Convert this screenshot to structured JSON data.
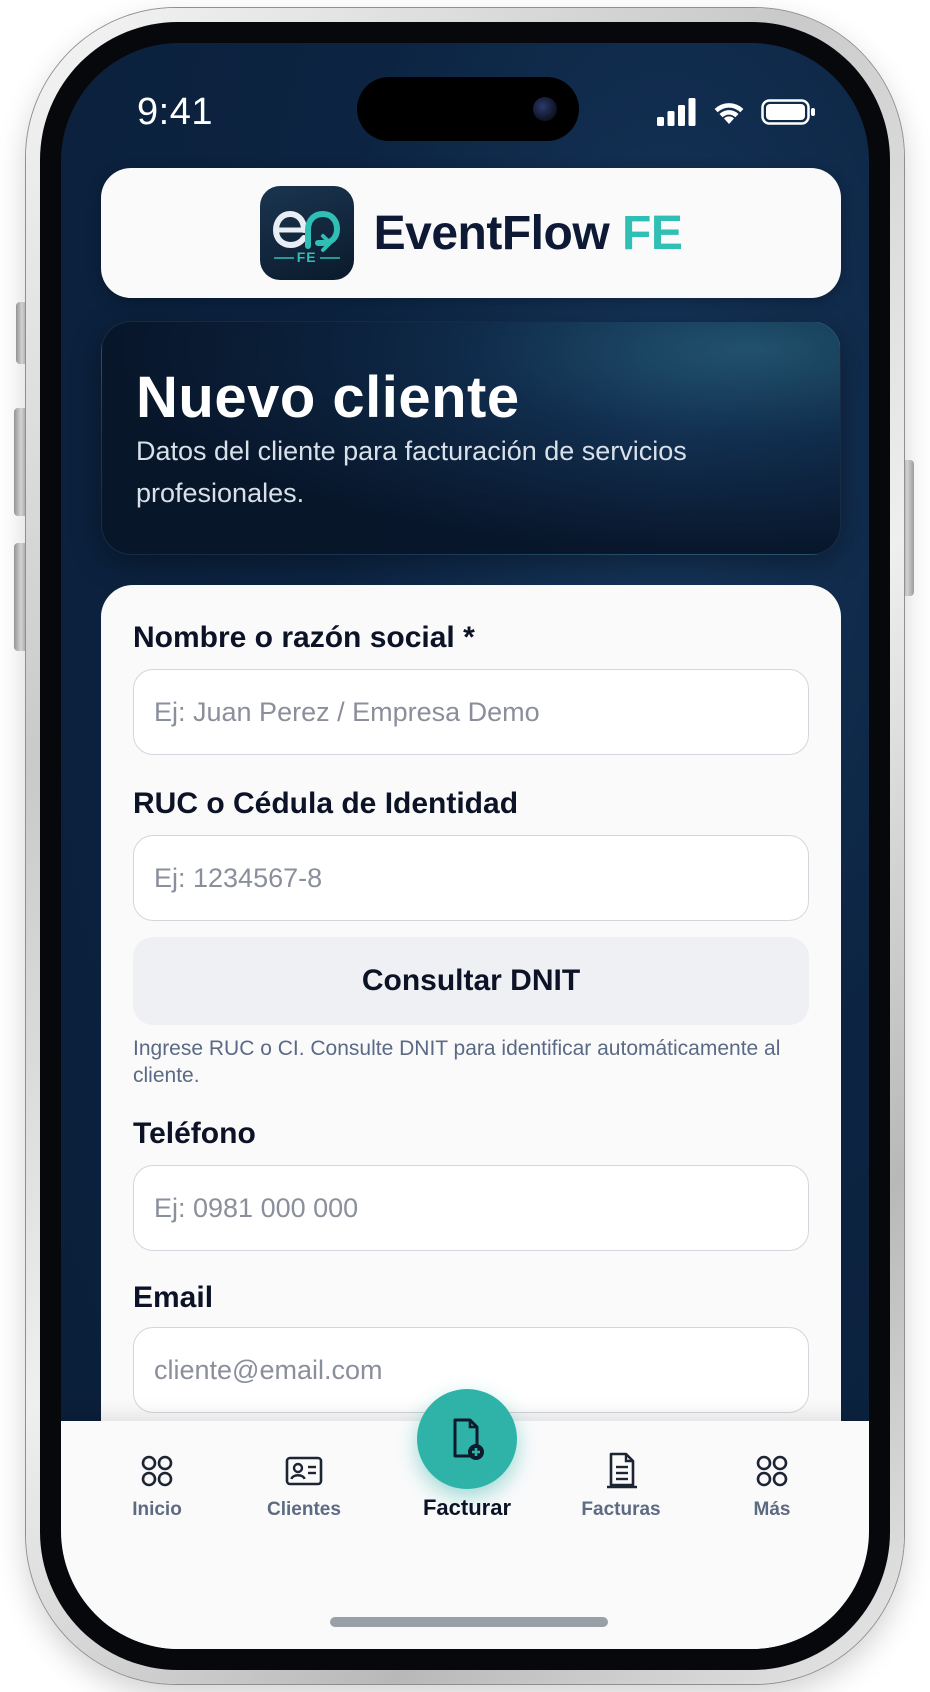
{
  "status_bar": {
    "time": "9:41"
  },
  "brand": {
    "logo_icon": "eventflow-logo-icon",
    "logo_badge": "FE",
    "name": "EventFlow",
    "suffix": "FE",
    "accent_color": "#2fbfb4",
    "dark_color": "#0e1a35"
  },
  "hero": {
    "title": "Nuevo cliente",
    "subtitle": "Datos del cliente para facturación de servicios profesionales."
  },
  "form": {
    "name_field": {
      "label": "Nombre o razón social *",
      "placeholder": "Ej: Juan Perez / Empresa Demo",
      "value": ""
    },
    "id_field": {
      "label": "RUC o Cédula de Identidad",
      "placeholder": "Ej: 1234567-8",
      "value": ""
    },
    "dnit_button": "Consultar DNIT",
    "dnit_helper": "Ingrese RUC o CI. Consulte DNIT para identificar automáticamente al cliente.",
    "phone_field": {
      "label": "Teléfono",
      "placeholder": "Ej: 0981 000 000",
      "value": ""
    },
    "email_field": {
      "label": "Email",
      "placeholder": "cliente@email.com",
      "value": ""
    }
  },
  "tab_bar": {
    "items": [
      {
        "label": "Inicio",
        "icon": "grid-icon"
      },
      {
        "label": "Clientes",
        "icon": "id-card-icon"
      },
      {
        "label": "Facturar",
        "icon": "document-add-icon",
        "primary": true
      },
      {
        "label": "Facturas",
        "icon": "document-icon"
      },
      {
        "label": "Más",
        "icon": "more-grid-icon"
      }
    ],
    "primary_color": "#2fb3a8"
  }
}
